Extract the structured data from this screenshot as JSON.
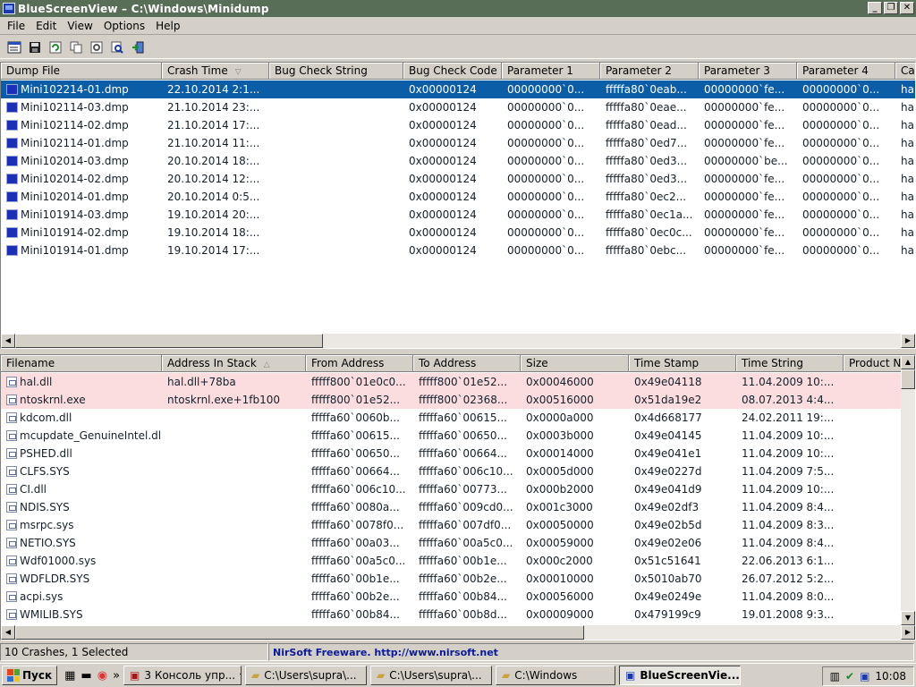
{
  "window": {
    "title": "BlueScreenView  –  C:\\Windows\\Minidump",
    "min": "_",
    "max": "❐",
    "close": "✕"
  },
  "menu": [
    "File",
    "Edit",
    "View",
    "Options",
    "Help"
  ],
  "toolbar_icons": [
    "properties-icon",
    "save-icon",
    "refresh-icon",
    "copy-icon",
    "advanced-options-icon",
    "find-icon",
    "exit-icon"
  ],
  "upper": {
    "columns": [
      "Dump File",
      "Crash Time",
      "Bug Check String",
      "Bug Check Code",
      "Parameter 1",
      "Parameter 2",
      "Parameter 3",
      "Parameter 4",
      "Ca"
    ],
    "sort_arrow": "▽",
    "rows": [
      [
        "Mini102214-01.dmp",
        "22.10.2014 2:1...",
        "",
        "0x00000124",
        "00000000`0...",
        "fffffa80`0eab...",
        "00000000`fe...",
        "00000000`0...",
        "hal"
      ],
      [
        "Mini102114-03.dmp",
        "21.10.2014 23:...",
        "",
        "0x00000124",
        "00000000`0...",
        "fffffa80`0eae...",
        "00000000`fe...",
        "00000000`0...",
        "hal"
      ],
      [
        "Mini102114-02.dmp",
        "21.10.2014 17:...",
        "",
        "0x00000124",
        "00000000`0...",
        "fffffa80`0ead...",
        "00000000`fe...",
        "00000000`0...",
        "hal"
      ],
      [
        "Mini102114-01.dmp",
        "21.10.2014 11:...",
        "",
        "0x00000124",
        "00000000`0...",
        "fffffa80`0ed7...",
        "00000000`fe...",
        "00000000`0...",
        "hal"
      ],
      [
        "Mini102014-03.dmp",
        "20.10.2014 18:...",
        "",
        "0x00000124",
        "00000000`0...",
        "fffffa80`0ed3...",
        "00000000`be...",
        "00000000`0...",
        "hal"
      ],
      [
        "Mini102014-02.dmp",
        "20.10.2014 12:...",
        "",
        "0x00000124",
        "00000000`0...",
        "fffffa80`0ed3...",
        "00000000`fe...",
        "00000000`0...",
        "hal"
      ],
      [
        "Mini102014-01.dmp",
        "20.10.2014 0:5...",
        "",
        "0x00000124",
        "00000000`0...",
        "fffffa80`0ec2...",
        "00000000`fe...",
        "00000000`0...",
        "hal"
      ],
      [
        "Mini101914-03.dmp",
        "19.10.2014 20:...",
        "",
        "0x00000124",
        "00000000`0...",
        "fffffa80`0ec1a...",
        "00000000`fe...",
        "00000000`0...",
        "hal"
      ],
      [
        "Mini101914-02.dmp",
        "19.10.2014 18:...",
        "",
        "0x00000124",
        "00000000`0...",
        "fffffa80`0ec0c...",
        "00000000`fe...",
        "00000000`0...",
        "hal"
      ],
      [
        "Mini101914-01.dmp",
        "19.10.2014 17:...",
        "",
        "0x00000124",
        "00000000`0...",
        "fffffa80`0ebc...",
        "00000000`fe...",
        "00000000`0...",
        "hal"
      ]
    ]
  },
  "lower": {
    "columns": [
      "Filename",
      "Address In Stack",
      "From Address",
      "To Address",
      "Size",
      "Time Stamp",
      "Time String",
      "Product N"
    ],
    "sort_arrow": "△",
    "rows": [
      [
        "hal.dll",
        "hal.dll+78ba",
        "fffff800`01e0c0...",
        "fffff800`01e52...",
        "0x00046000",
        "0x49e04118",
        "11.04.2009 10:..."
      ],
      [
        "ntoskrnl.exe",
        "ntoskrnl.exe+1fb100",
        "fffff800`01e52...",
        "fffff800`02368...",
        "0x00516000",
        "0x51da19e2",
        "08.07.2013 4:4..."
      ],
      [
        "kdcom.dll",
        "",
        "fffffa60`0060b...",
        "fffffa60`00615...",
        "0x0000a000",
        "0x4d668177",
        "24.02.2011 19:..."
      ],
      [
        "mcupdate_GenuineIntel.dll",
        "",
        "fffffa60`00615...",
        "fffffa60`00650...",
        "0x0003b000",
        "0x49e04145",
        "11.04.2009 10:..."
      ],
      [
        "PSHED.dll",
        "",
        "fffffa60`00650...",
        "fffffa60`00664...",
        "0x00014000",
        "0x49e041e1",
        "11.04.2009 10:..."
      ],
      [
        "CLFS.SYS",
        "",
        "fffffa60`00664...",
        "fffffa60`006c10...",
        "0x0005d000",
        "0x49e0227d",
        "11.04.2009 7:5..."
      ],
      [
        "CI.dll",
        "",
        "fffffa60`006c10...",
        "fffffa60`00773...",
        "0x000b2000",
        "0x49e041d9",
        "11.04.2009 10:..."
      ],
      [
        "NDIS.SYS",
        "",
        "fffffa60`0080a...",
        "fffffa60`009cd0...",
        "0x001c3000",
        "0x49e02df3",
        "11.04.2009 8:4..."
      ],
      [
        "msrpc.sys",
        "",
        "fffffa60`0078f0...",
        "fffffa60`007df0...",
        "0x00050000",
        "0x49e02b5d",
        "11.04.2009 8:3..."
      ],
      [
        "NETIO.SYS",
        "",
        "fffffa60`00a03...",
        "fffffa60`00a5c0...",
        "0x00059000",
        "0x49e02e06",
        "11.04.2009 8:4..."
      ],
      [
        "Wdf01000.sys",
        "",
        "fffffa60`00a5c0...",
        "fffffa60`00b1e...",
        "0x000c2000",
        "0x51c51641",
        "22.06.2013 6:1..."
      ],
      [
        "WDFLDR.SYS",
        "",
        "fffffa60`00b1e...",
        "fffffa60`00b2e...",
        "0x00010000",
        "0x5010ab70",
        "26.07.2012 5:2..."
      ],
      [
        "acpi.sys",
        "",
        "fffffa60`00b2e...",
        "fffffa60`00b84...",
        "0x00056000",
        "0x49e0249e",
        "11.04.2009 8:0..."
      ],
      [
        "WMILIB.SYS",
        "",
        "fffffa60`00b84...",
        "fffffa60`00b8d...",
        "0x00009000",
        "0x479199c9",
        "19.01.2008 9:3..."
      ]
    ]
  },
  "status": {
    "count": "10 Crashes, 1 Selected",
    "link": "NirSoft Freeware.  http://www.nirsoft.net"
  },
  "taskbar": {
    "start": "Пуск",
    "tasks": [
      "3  Консоль упр...",
      "C:\\Users\\supra\\...",
      "C:\\Users\\supra\\...",
      "C:\\Windows",
      "BlueScreenVie..."
    ],
    "clock": "10:08"
  },
  "colors": {
    "selection": "#0b5da7",
    "highlight_row": "#fbdde0",
    "titlebar": "#596e57"
  }
}
